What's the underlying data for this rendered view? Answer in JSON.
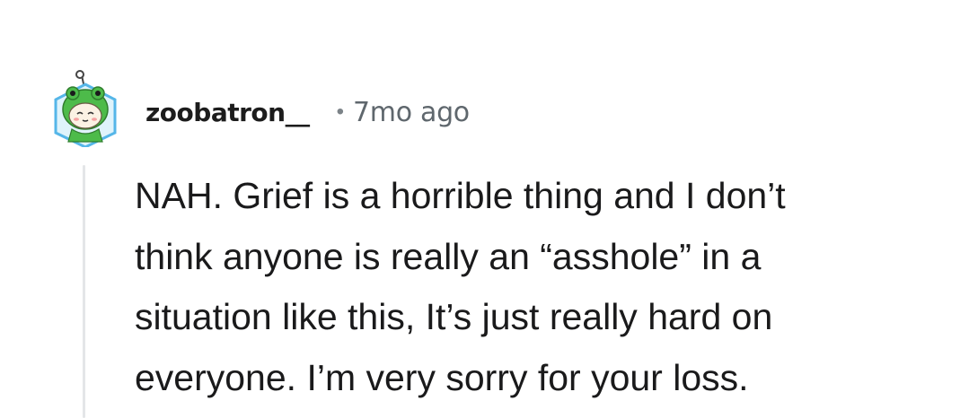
{
  "comment": {
    "author": "zoobatron__",
    "separator": "•",
    "timestamp": "7mo ago",
    "body": "NAH. Grief is a horrible thing and I don’t\nthink anyone is really an “asshole” in a\nsituation like this, It’s just really hard on\neveryone. I’m very sorry for your loss.",
    "avatar_icon": "snoo-avatar-frog-hood-icon"
  },
  "colors": {
    "avatar_frame": "#55b6e8",
    "avatar_hood": "#4dbb4a",
    "thread_line": "#e4e6e8",
    "text": "#1a1a1b",
    "meta": "#5f676d"
  }
}
